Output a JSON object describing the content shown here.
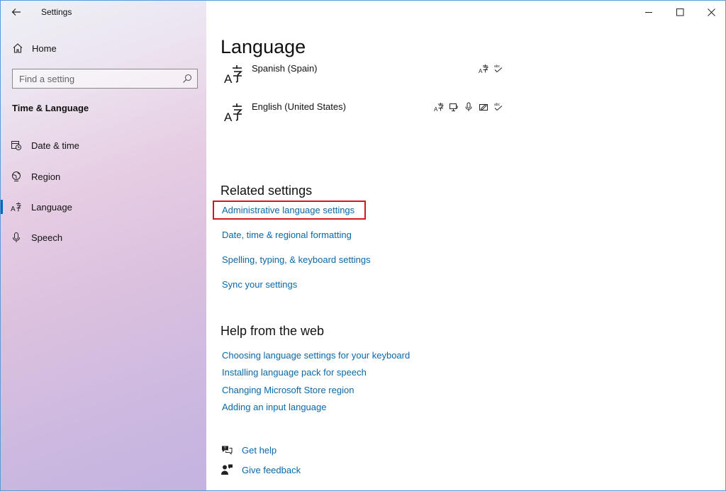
{
  "window": {
    "title": "Settings"
  },
  "sidebar": {
    "home_label": "Home",
    "search_placeholder": "Find a setting",
    "section_title": "Time & Language",
    "items": [
      {
        "label": "Date & time",
        "icon": "calendar-clock-icon"
      },
      {
        "label": "Region",
        "icon": "globe-icon"
      },
      {
        "label": "Language",
        "icon": "language-icon",
        "active": true
      },
      {
        "label": "Speech",
        "icon": "microphone-icon"
      }
    ]
  },
  "main": {
    "title": "Language",
    "languages": [
      {
        "name": "Spanish (Spain)",
        "features": [
          "display-language-icon",
          "spelling-icon"
        ]
      },
      {
        "name": "English (United States)",
        "features": [
          "display-language-icon",
          "text-to-speech-icon",
          "speech-recognition-icon",
          "handwriting-icon",
          "spelling-icon"
        ]
      }
    ],
    "related_title": "Related settings",
    "related_links": [
      "Administrative language settings",
      "Date, time & regional formatting",
      "Spelling, typing, & keyboard settings",
      "Sync your settings"
    ],
    "web_title": "Help from the web",
    "web_links": [
      "Choosing language settings for your keyboard",
      "Installing language pack for speech",
      "Changing Microsoft Store region",
      "Adding an input language"
    ],
    "get_help": "Get help",
    "give_feedback": "Give feedback"
  },
  "colors": {
    "accent": "#0067b8",
    "link": "#0a68a8",
    "highlight": "#d3171f"
  }
}
